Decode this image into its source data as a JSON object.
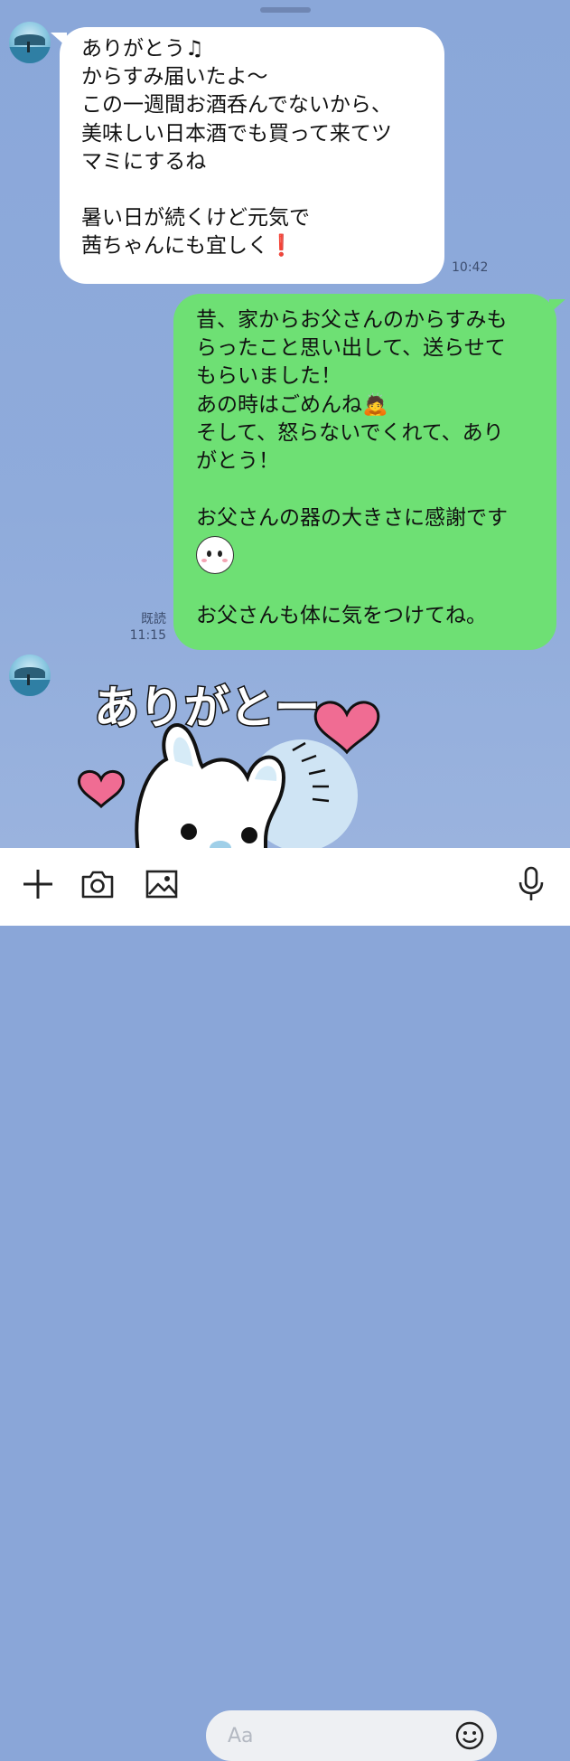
{
  "chat": {
    "incoming_1": {
      "text": "ありがとう♫\nからすみ届いたよ〜\nこの一週間お酒呑んでないから、\n美味しい日本酒でも買って来てツ\nマミにするね\n\n暑い日が続くけど元気で\n茜ちゃんにも宜しく",
      "emoji": "❗",
      "time": "10:42"
    },
    "outgoing_1": {
      "text_1": "昔、家からお父さんのからすみも\nらったこと思い出して、送らせて\nもらいました！\nあの時はごめんね",
      "emoji_bow": "🙇",
      "text_2": "\nそして、怒らないでくれて、あり\nがとう！\n\nお父さんの器の大きさに感謝です",
      "text_3": "\n\nお父さんも体に気をつけてね。",
      "read_label": "既読",
      "time": "11:15"
    },
    "sticker": {
      "text": "ありがとー",
      "icon": "rabbit-sticker-heart"
    }
  },
  "toolbar": {
    "input_placeholder": "Aa",
    "icons": [
      "plus-icon",
      "camera-icon",
      "image-icon",
      "emoji-icon",
      "microphone-icon"
    ]
  }
}
